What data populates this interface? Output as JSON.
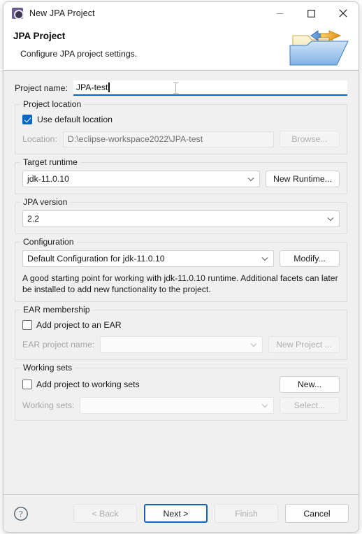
{
  "window": {
    "title": "New JPA Project",
    "icon": "jpa-project-icon",
    "minimize_label": "—",
    "maximize_label": "□",
    "close_label": "✕"
  },
  "header": {
    "title": "JPA Project",
    "subtitle": "Configure JPA project settings.",
    "art_icon": "folder-with-arrows-icon"
  },
  "project_name": {
    "label": "Project name:",
    "value": "JPA-test",
    "placeholder": ""
  },
  "project_location": {
    "legend": "Project location",
    "use_default_label": "Use default location",
    "use_default_checked": true,
    "location_label": "Location:",
    "location_value": "D:\\eclipse-workspace2022\\JPA-test",
    "browse_label": "Browse...",
    "browse_enabled": false
  },
  "target_runtime": {
    "legend": "Target runtime",
    "value": "jdk-11.0.10",
    "new_runtime_label": "New Runtime..."
  },
  "jpa_version": {
    "legend": "JPA version",
    "value": "2.2"
  },
  "configuration": {
    "legend": "Configuration",
    "value": "Default Configuration for jdk-11.0.10",
    "modify_label": "Modify...",
    "description": "A good starting point for working with jdk-11.0.10 runtime. Additional facets can later be installed to add new functionality to the project."
  },
  "ear_membership": {
    "legend": "EAR membership",
    "add_to_ear_label": "Add project to an EAR",
    "add_to_ear_checked": false,
    "ear_project_name_label": "EAR project name:",
    "ear_project_name_value": "",
    "new_project_label": "New Project ...",
    "enabled": false
  },
  "working_sets": {
    "legend": "Working sets",
    "add_to_working_sets_label": "Add project to working sets",
    "add_to_working_sets_checked": false,
    "working_sets_label": "Working sets:",
    "working_sets_value": "",
    "new_label": "New...",
    "select_label": "Select...",
    "select_enabled": false
  },
  "footer": {
    "help_icon": "help-question-icon",
    "back_label": "< Back",
    "back_enabled": false,
    "next_label": "Next >",
    "next_is_default": true,
    "finish_label": "Finish",
    "finish_enabled": false,
    "cancel_label": "Cancel"
  },
  "colors": {
    "accent": "#0a66c2",
    "dialog_bg": "#f0f0f0",
    "header_bg": "#ffffff",
    "title_icon": "#6b5b95"
  }
}
